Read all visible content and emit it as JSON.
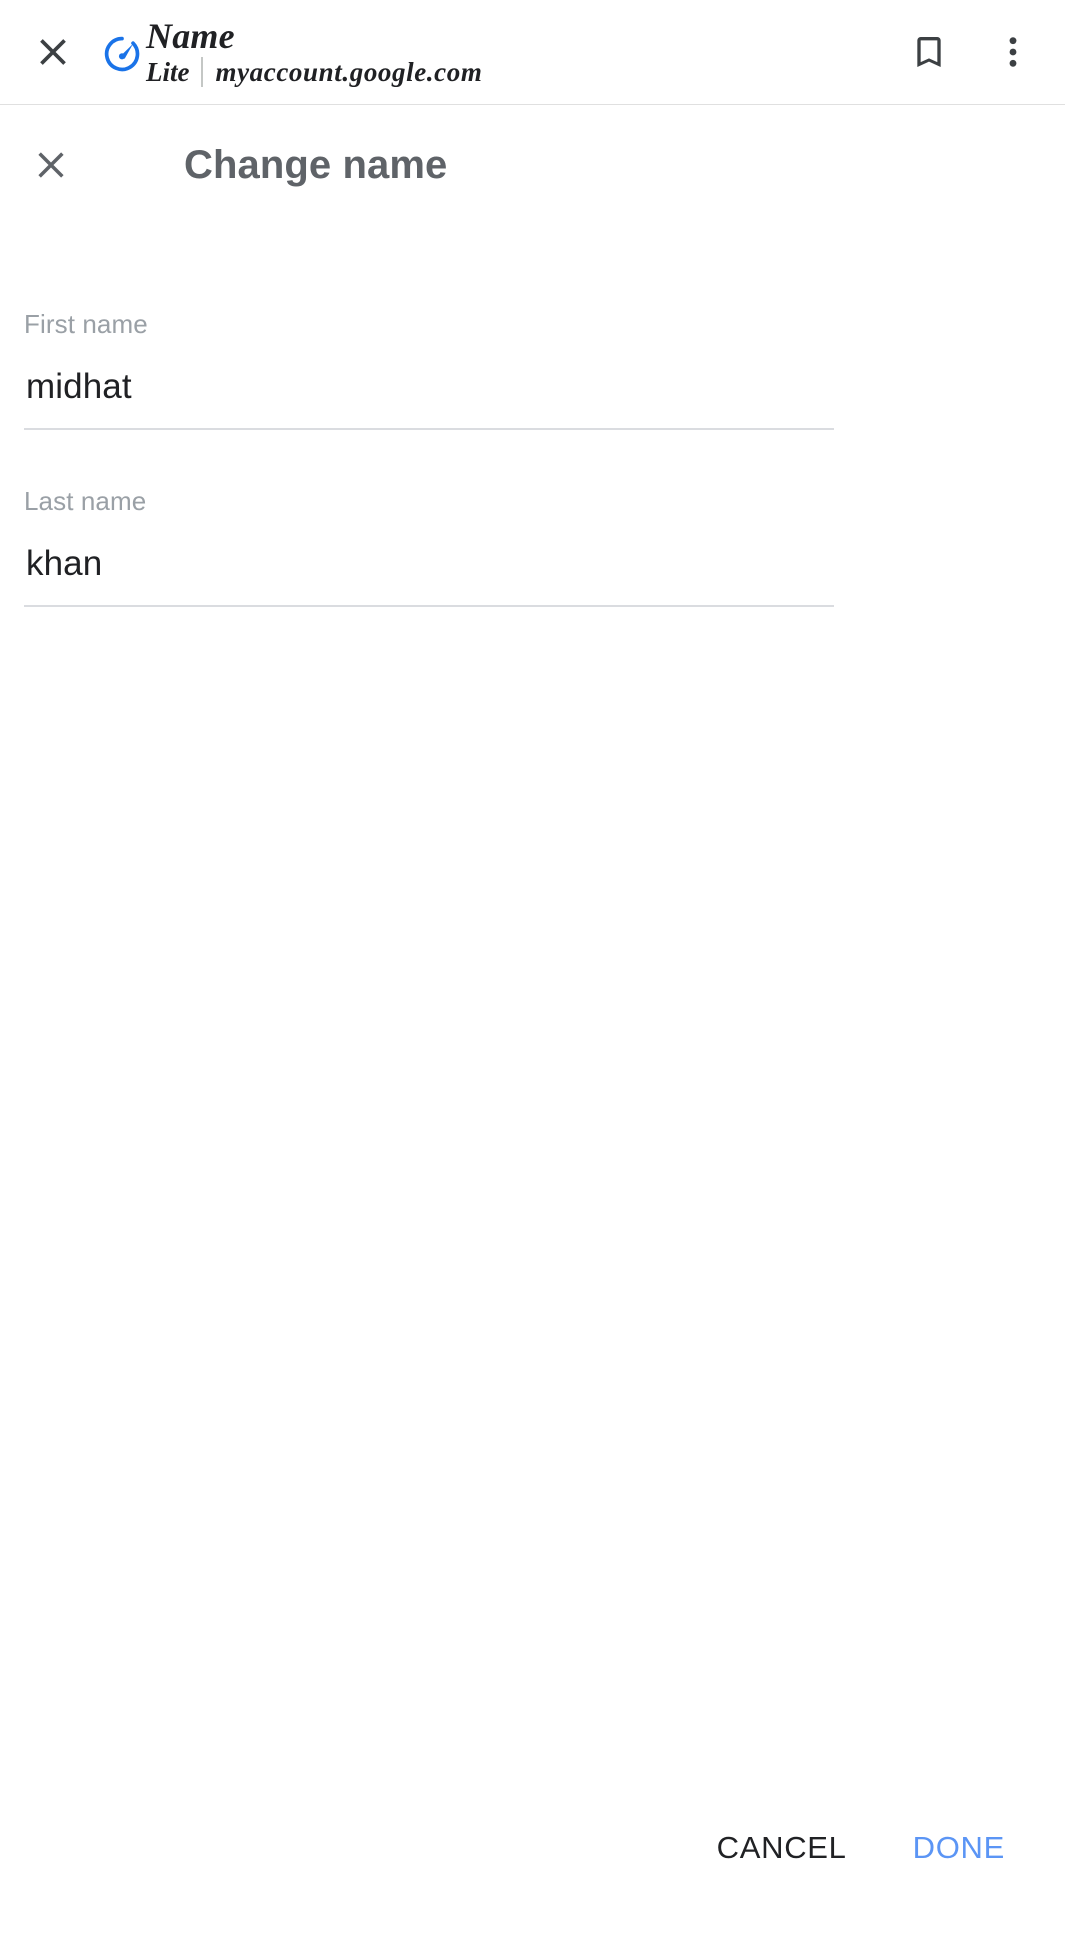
{
  "browser_bar": {
    "close_label": "close-tab",
    "page_title": "Name",
    "lite_label": "Lite",
    "origin": "myaccount.google.com",
    "lite_icon": "speedometer-icon",
    "bookmark_icon": "bookmark-icon",
    "overflow_icon": "more-vertical-icon",
    "accent_blue": "#1a73e8"
  },
  "dialog": {
    "close_icon": "close-icon",
    "title": "Change name"
  },
  "form": {
    "fields": [
      {
        "id": "first-name",
        "label": "First name",
        "value": "midhat",
        "placeholder": "First name"
      },
      {
        "id": "last-name",
        "label": "Last name",
        "value": "khan",
        "placeholder": "Last name"
      }
    ]
  },
  "footer": {
    "cancel_label": "CANCEL",
    "done_label": "DONE",
    "done_color": "#5b95f5"
  }
}
